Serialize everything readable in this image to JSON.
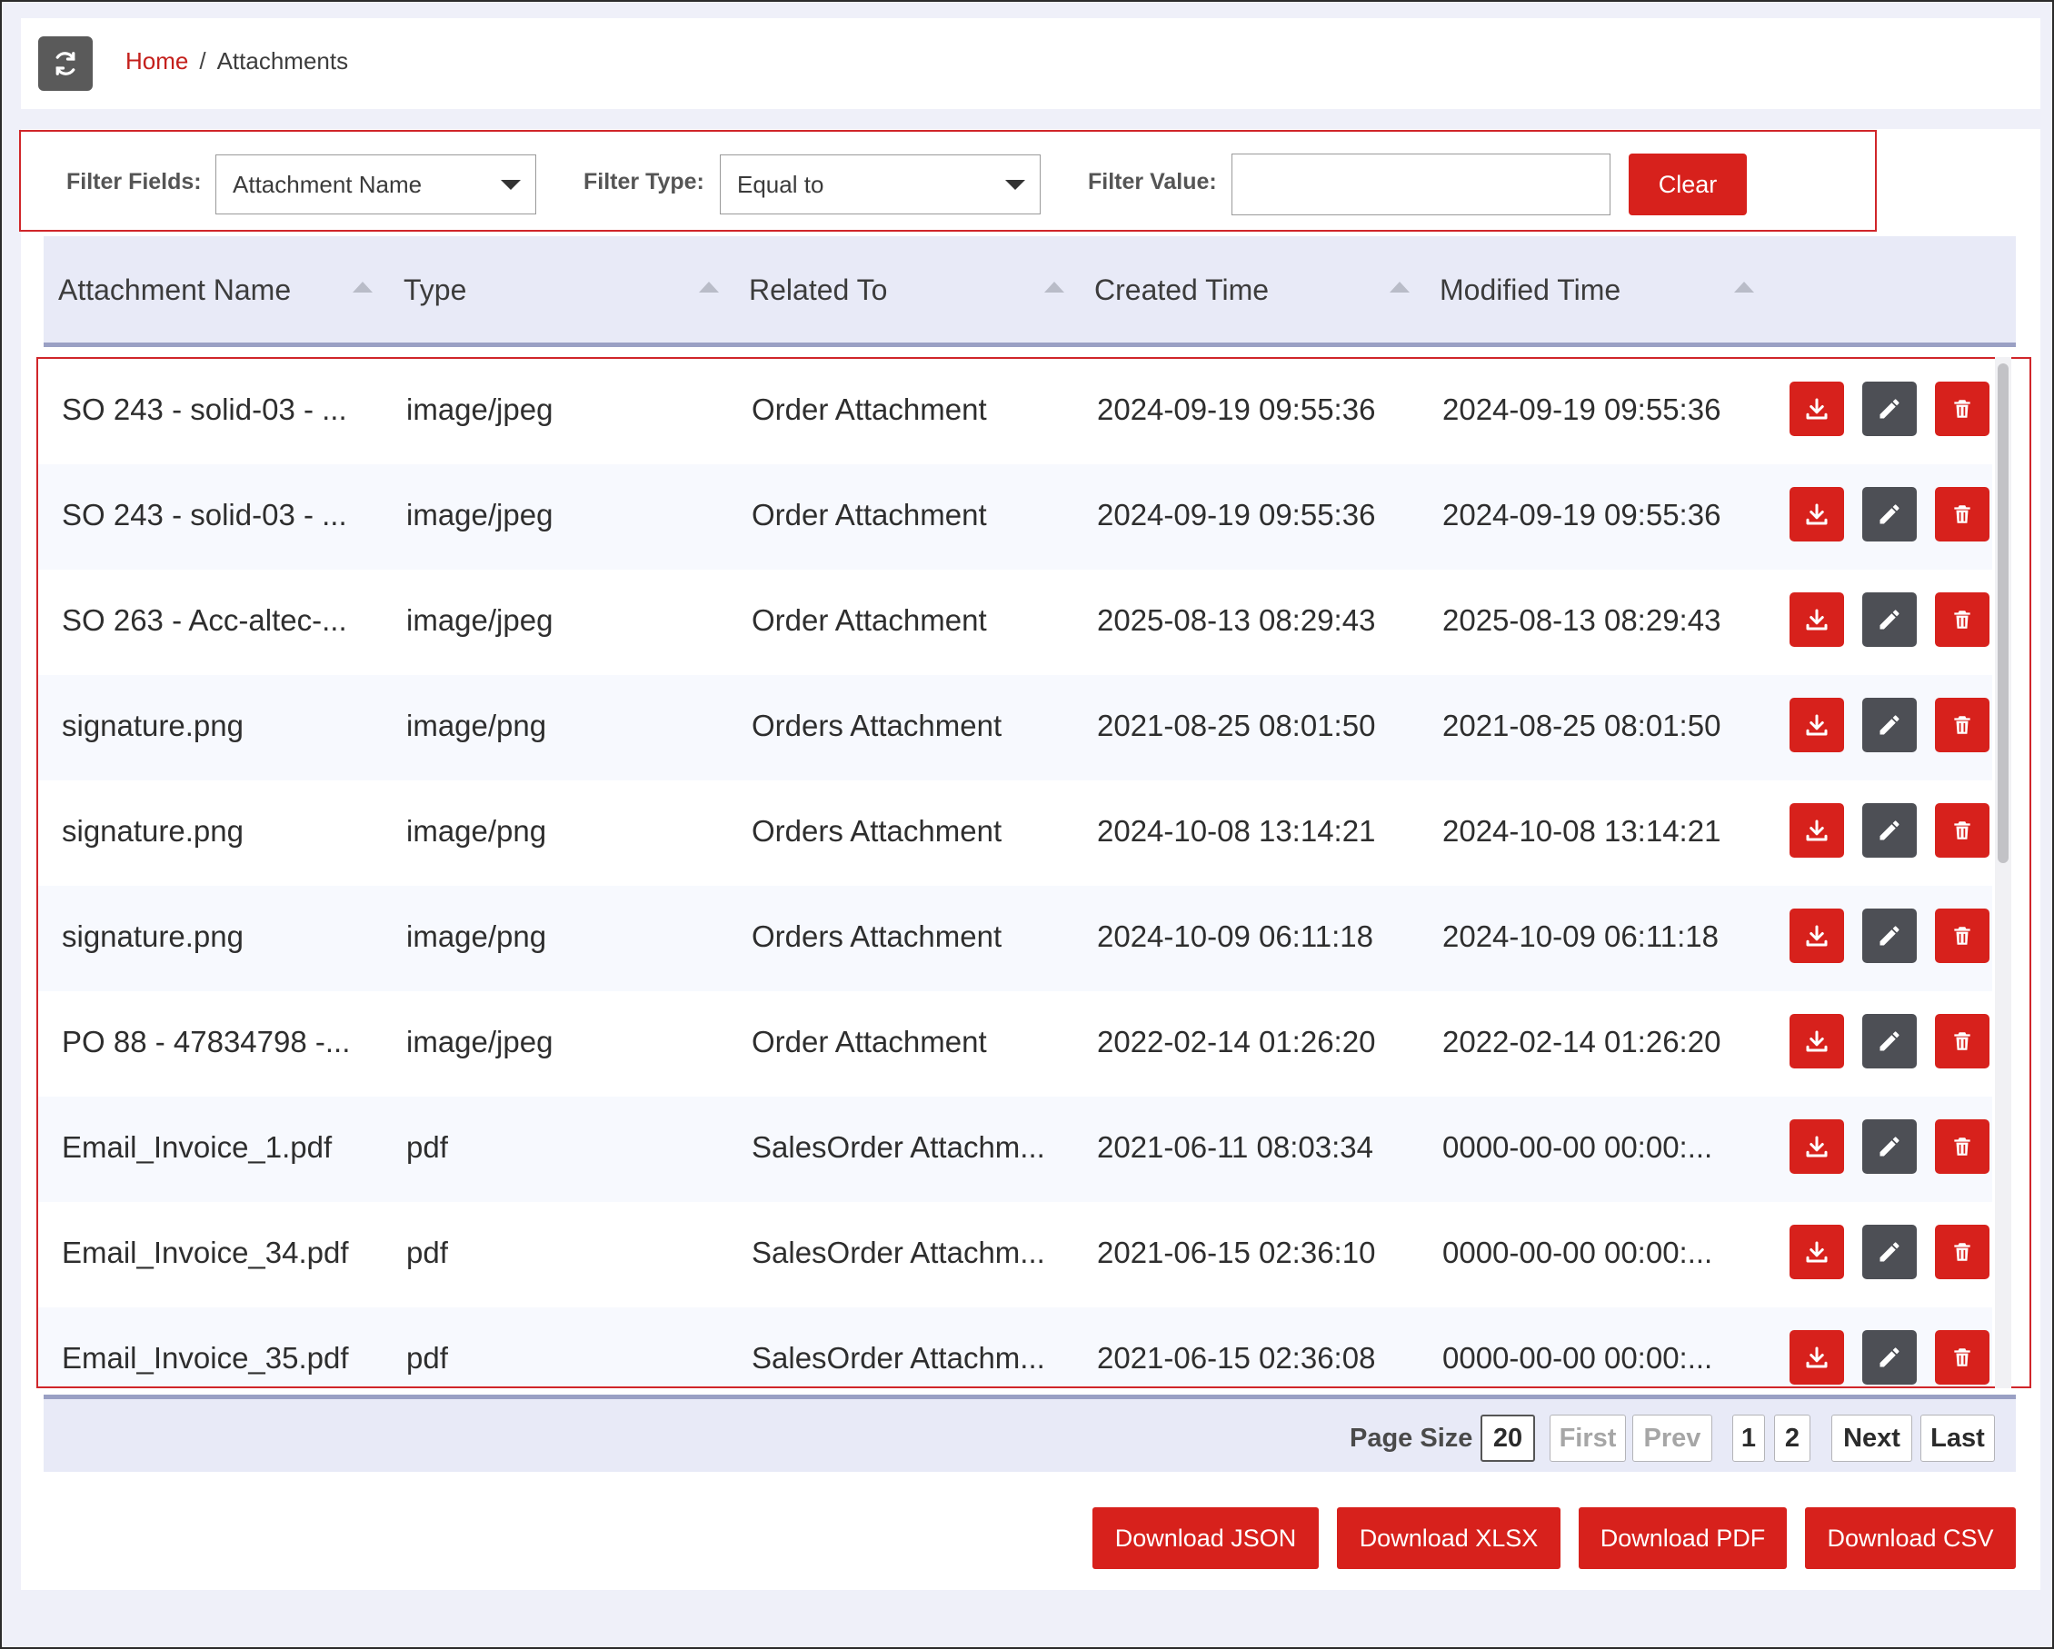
{
  "breadcrumb": {
    "home": "Home",
    "separator": "/",
    "current": "Attachments"
  },
  "filter": {
    "fields_label": "Filter Fields:",
    "fields_value": "Attachment Name",
    "type_label": "Filter Type:",
    "type_value": "Equal to",
    "value_label": "Filter Value:",
    "value_input": "",
    "clear_label": "Clear"
  },
  "table": {
    "columns": [
      "Attachment Name",
      "Type",
      "Related To",
      "Created Time",
      "Modified Time"
    ],
    "rows": [
      [
        "SO 243 - solid-03 - ...",
        "image/jpeg",
        "Order Attachment",
        "2024-09-19 09:55:36",
        "2024-09-19 09:55:36"
      ],
      [
        "SO 243 - solid-03 - ...",
        "image/jpeg",
        "Order Attachment",
        "2024-09-19 09:55:36",
        "2024-09-19 09:55:36"
      ],
      [
        "SO 263 - Acc-altec-...",
        "image/jpeg",
        "Order Attachment",
        "2025-08-13 08:29:43",
        "2025-08-13 08:29:43"
      ],
      [
        "signature.png",
        "image/png",
        "Orders Attachment",
        "2021-08-25 08:01:50",
        "2021-08-25 08:01:50"
      ],
      [
        "signature.png",
        "image/png",
        "Orders Attachment",
        "2024-10-08 13:14:21",
        "2024-10-08 13:14:21"
      ],
      [
        "signature.png",
        "image/png",
        "Orders Attachment",
        "2024-10-09 06:11:18",
        "2024-10-09 06:11:18"
      ],
      [
        "PO 88 - 47834798 -...",
        "image/jpeg",
        "Order Attachment",
        "2022-02-14 01:26:20",
        "2022-02-14 01:26:20"
      ],
      [
        "Email_Invoice_1.pdf",
        "pdf",
        "SalesOrder Attachm...",
        "2021-06-11 08:03:34",
        "0000-00-00 00:00:..."
      ],
      [
        "Email_Invoice_34.pdf",
        "pdf",
        "SalesOrder Attachm...",
        "2021-06-15 02:36:10",
        "0000-00-00 00:00:..."
      ],
      [
        "Email_Invoice_35.pdf",
        "pdf",
        "SalesOrder Attachm...",
        "2021-06-15 02:36:08",
        "0000-00-00 00:00:..."
      ]
    ]
  },
  "pagination": {
    "page_size_label": "Page Size",
    "page_size": "20",
    "first": "First",
    "prev": "Prev",
    "pages": [
      "1",
      "2"
    ],
    "next": "Next",
    "last": "Last"
  },
  "downloads": {
    "json": "Download JSON",
    "xlsx": "Download XLSX",
    "pdf": "Download PDF",
    "csv": "Download CSV"
  },
  "icons": {
    "refresh": "refresh-icon",
    "download": "download-icon",
    "edit": "pencil-icon",
    "delete": "trash-icon",
    "sort": "sort-up-icon",
    "dropdown": "caret-down-icon"
  },
  "colors": {
    "accent": "#d7211c",
    "edit_button": "#4d4f55",
    "header_bg": "#e8eaf7",
    "page_bg": "#eff0f9"
  }
}
